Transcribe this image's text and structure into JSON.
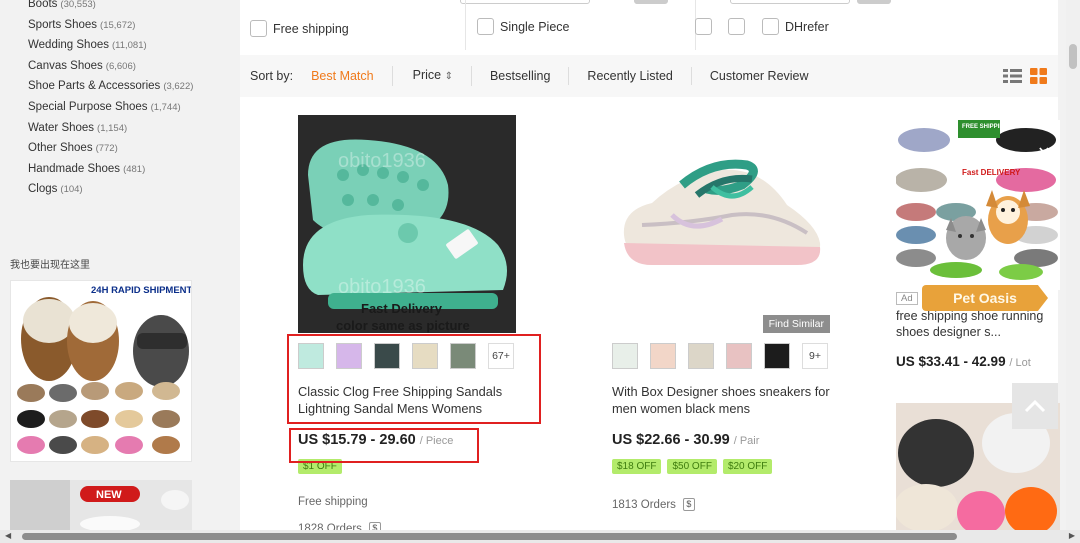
{
  "sidebar": {
    "categories": [
      {
        "label": "Boots",
        "count": "(30,553)"
      },
      {
        "label": "Sports Shoes",
        "count": "(15,672)"
      },
      {
        "label": "Wedding Shoes",
        "count": "(11,081)"
      },
      {
        "label": "Canvas Shoes",
        "count": "(6,606)"
      },
      {
        "label": "Shoe Parts & Accessories",
        "count": "(3,622)"
      },
      {
        "label": "Special Purpose Shoes",
        "count": "(1,744)"
      },
      {
        "label": "Water Shoes",
        "count": "(1,154)"
      },
      {
        "label": "Other Shoes",
        "count": "(772)"
      },
      {
        "label": "Handmade Shoes",
        "count": "(481)"
      },
      {
        "label": "Clogs",
        "count": "(104)"
      }
    ],
    "promo_heading": "我也要出现在这里",
    "promo_banner_text": "24H RAPID SHIPMENT",
    "promo2_text": "NEW"
  },
  "filters": {
    "free_shipping": "Free shipping",
    "single_piece": "Single Piece",
    "dhrefer": "DHrefer"
  },
  "sort": {
    "label": "Sort by:",
    "options": [
      "Best Match",
      "Price",
      "Bestselling",
      "Recently Listed",
      "Customer Review"
    ],
    "active": "Best Match"
  },
  "products": [
    {
      "watermark": "obito1936",
      "overlay_line1": "Fast Delivery",
      "overlay_line2": "color same as picture",
      "more_thumbs": "67+",
      "title": "Classic Clog Free Shipping Sandals Lightning Sandal Mens Womens",
      "price": "US $15.79 - 29.60",
      "unit": "/ Piece",
      "coupons": [
        "$1 OFF"
      ],
      "shipping": "Free shipping",
      "orders": "1828 Orders"
    },
    {
      "more_thumbs": "9+",
      "find_similar": "Find Similar",
      "title": "With Box Designer shoes sneakers for men women black mens",
      "price": "US $22.66 - 30.99",
      "unit": "/ Pair",
      "coupons": [
        "$18 OFF",
        "$50 OFF",
        "$20 OFF"
      ],
      "orders": "1813 Orders"
    }
  ],
  "ad": {
    "tag": "Ad",
    "title": "free shipping shoe running shoes designer s...",
    "price": "US $33.41 - 42.99",
    "unit": "/ Lot",
    "banner": "Pet Oasis",
    "ribbon1": "FREE SHIPPING",
    "ribbon2": "Fast DELIVERY"
  },
  "colors": {
    "accent": "#f07a1b",
    "coupon_bg": "#b3eb6b",
    "highlight": "#e02020"
  }
}
